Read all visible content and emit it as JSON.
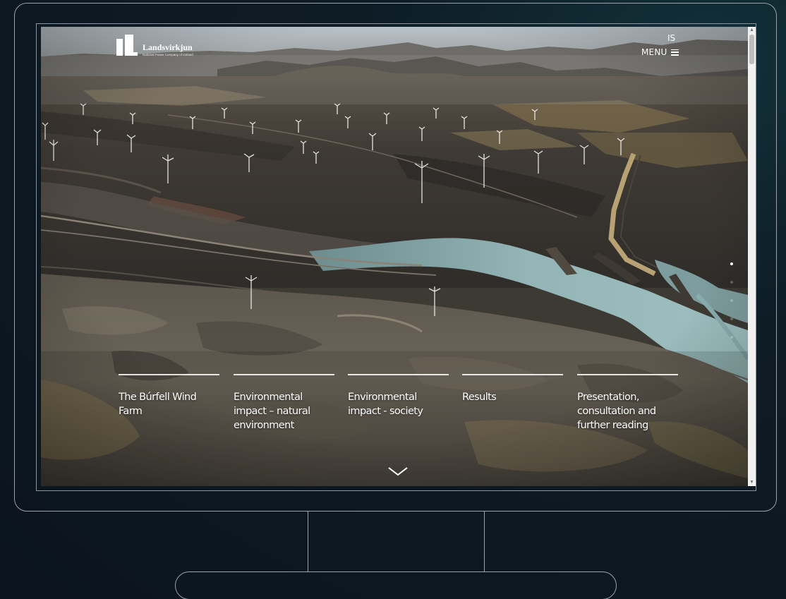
{
  "header": {
    "logo_name": "Landsvirkjun",
    "logo_tagline": "National Power Company of Iceland",
    "language_label": "IS",
    "menu_label": "MENU"
  },
  "nav": {
    "items": [
      {
        "label_lines": [
          "The Búrfell Wind",
          "Farm"
        ]
      },
      {
        "label_lines": [
          "Environmental",
          "impact – natural",
          "environment"
        ]
      },
      {
        "label_lines": [
          "Environmental",
          "impact - society"
        ]
      },
      {
        "label_lines": [
          "Results"
        ]
      },
      {
        "label_lines": [
          "Presentation,",
          "consultation and",
          "further reading"
        ]
      }
    ]
  },
  "section_indicator": {
    "count": 5,
    "active_index": 0
  },
  "icons": {
    "menu": "hamburger-icon",
    "scroll_down": "chevron-down-icon",
    "logo": "landsvirkjun-logo-mark"
  },
  "colors": {
    "text": "#ffffff",
    "water": "#8fb2b3",
    "ground_dark": "#2f2c28",
    "ground_light": "#7a7060"
  }
}
